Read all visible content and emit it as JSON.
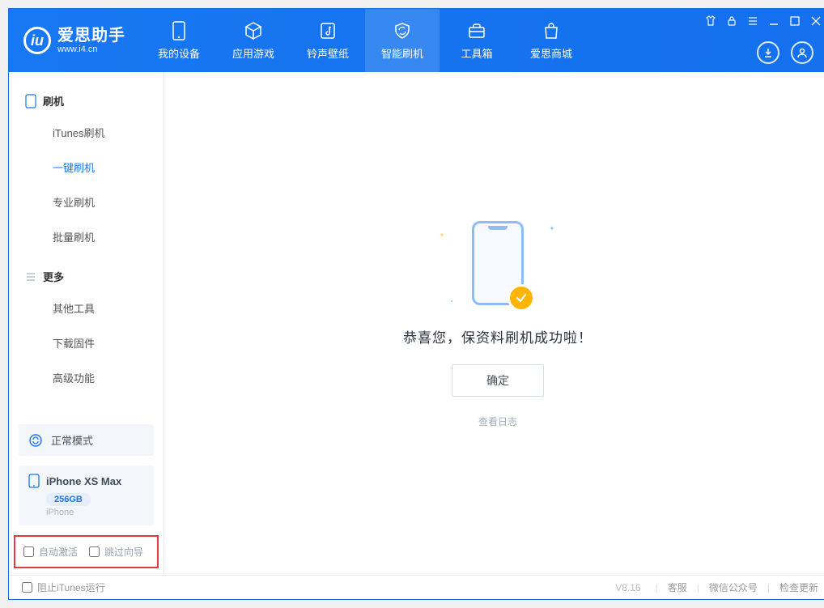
{
  "app": {
    "title": "爱思助手",
    "subtitle": "www.i4.cn"
  },
  "top_tabs": [
    {
      "label": "我的设备"
    },
    {
      "label": "应用游戏"
    },
    {
      "label": "铃声壁纸"
    },
    {
      "label": "智能刷机"
    },
    {
      "label": "工具箱"
    },
    {
      "label": "爱思商城"
    }
  ],
  "sidebar": {
    "group1_title": "刷机",
    "items1": [
      {
        "label": "iTunes刷机"
      },
      {
        "label": "一键刷机"
      },
      {
        "label": "专业刷机"
      },
      {
        "label": "批量刷机"
      }
    ],
    "group2_title": "更多",
    "items2": [
      {
        "label": "其他工具"
      },
      {
        "label": "下载固件"
      },
      {
        "label": "高级功能"
      }
    ]
  },
  "status": {
    "mode": "正常模式"
  },
  "device": {
    "name": "iPhone XS Max",
    "storage": "256GB",
    "type": "iPhone"
  },
  "options": {
    "auto_activate": "自动激活",
    "skip_guide": "跳过向导"
  },
  "main": {
    "success_text": "恭喜您，保资料刷机成功啦！",
    "ok_label": "确定",
    "view_log": "查看日志"
  },
  "statusbar": {
    "block_itunes": "阻止iTunes运行",
    "version": "V8.16",
    "links": [
      "客服",
      "微信公众号",
      "检查更新"
    ]
  }
}
